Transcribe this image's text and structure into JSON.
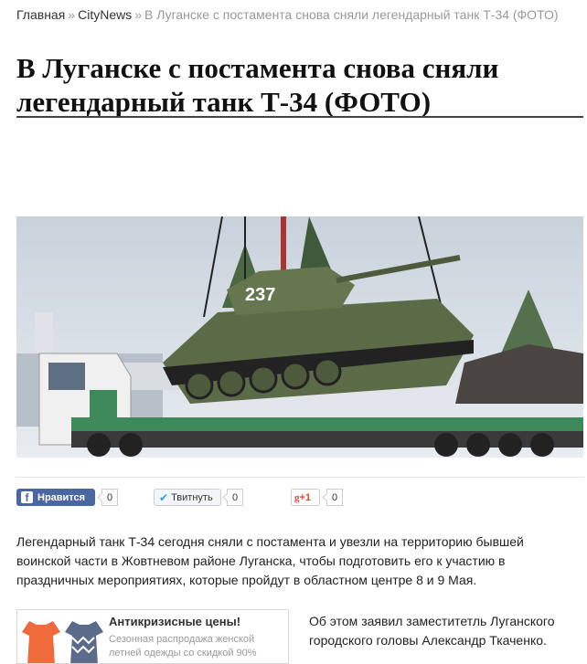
{
  "breadcrumb": {
    "home": "Главная",
    "separator": "»",
    "section": "CityNews",
    "current": "В Луганске с постамента снова сняли легендарный танк Т-34 (ФОТО)"
  },
  "article": {
    "title": "В Луганске с постамента снова сняли легендарный танк Т-34 (ФОТО)",
    "photo": {
      "tank_number": "237"
    },
    "lead": "Легендарный танк Т-34 сегодня сняли с постамента и увезли на территорию бывшей воинской части в Жовтневом районе Луганска, чтобы подготовить его к участию в праздничных мероприятиях, которые пройдут в областном центре 8 и 9 Мая.",
    "continuation": "Об этом заявил заместитетль Луганского городского головы Александр Ткаченко."
  },
  "share": {
    "facebook": {
      "label": "Нравится",
      "count": "0"
    },
    "twitter": {
      "label": "Твитнуть",
      "count": "0"
    },
    "google": {
      "label": "+1",
      "count": "0"
    }
  },
  "ad": {
    "title": "Антикризисные цены!",
    "text": "Сезонная распродажа женской летней одежды со скидкой 90%"
  },
  "colors": {
    "facebook": "#4b67a1",
    "twitter_icon": "#2a9fd8",
    "google": "#dd4b39",
    "title_rule": "#444444"
  }
}
